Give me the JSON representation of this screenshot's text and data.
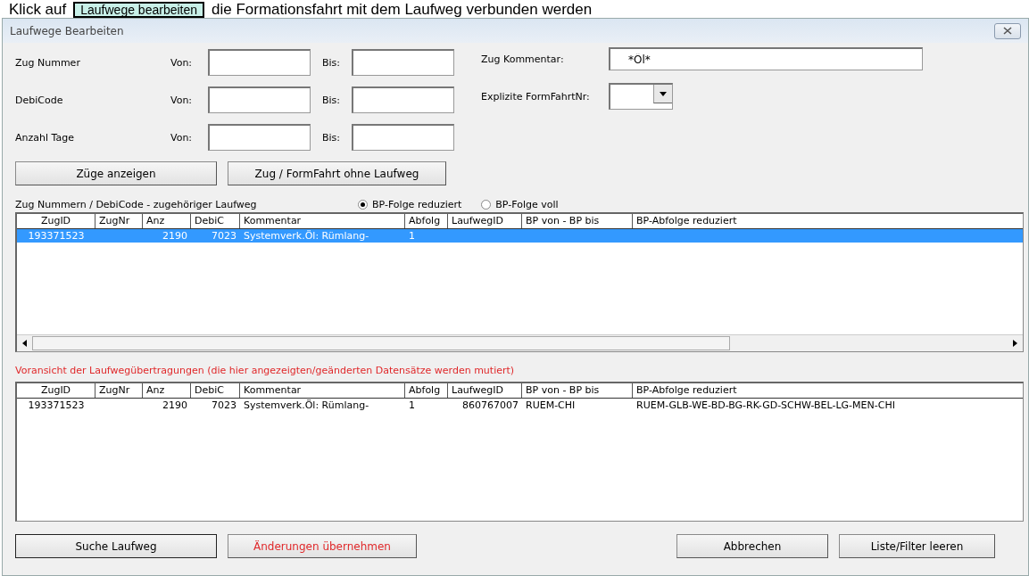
{
  "caption": {
    "before": "Klick auf",
    "button": "Laufwege bearbeiten",
    "after": "die Formationsfahrt mit dem Laufweg verbunden werden"
  },
  "window": {
    "title": "Laufwege Bearbeiten"
  },
  "filters": [
    {
      "label": "Zug Nummer",
      "from_label": "Von:",
      "to_label": "Bis:"
    },
    {
      "label": "DebiCode",
      "from_label": "Von:",
      "to_label": "Bis:"
    },
    {
      "label": "Anzahl Tage",
      "from_label": "Von:",
      "to_label": "Bis:"
    }
  ],
  "comment": {
    "label": "Zug Kommentar:",
    "value": "*Öl*"
  },
  "formfahrt": {
    "label": "Explizite FormFahrtNr:"
  },
  "action_buttons": [
    "Züge anzeigen",
    "Zug / FormFahrt ohne Laufweg"
  ],
  "list_label": "Zug Nummern / DebiCode - zugehöriger Laufweg",
  "radios": [
    {
      "label": "BP-Folge reduziert",
      "selected": true
    },
    {
      "label": "BP-Folge voll",
      "selected": false
    }
  ],
  "table": {
    "columns": [
      "ZugID",
      "ZugNr",
      "Anz",
      "DebiC",
      "Kommentar",
      "Abfolg",
      "LaufwegID",
      "BP von - BP bis",
      "BP-Abfolge reduziert"
    ],
    "rows": [
      {
        "selected": true,
        "cells": [
          "193371523",
          "",
          "2190",
          "7023",
          "Systemverk.Öl: Rümlang-",
          "1",
          "",
          "",
          ""
        ]
      }
    ]
  },
  "preview_label": "Voransicht der Laufwegübertragungen (die hier angezeigten/geänderten Datensätze werden mutiert)",
  "preview_table": {
    "columns": [
      "ZugID",
      "ZugNr",
      "Anz",
      "DebiC",
      "Kommentar",
      "Abfolg",
      "LaufwegID",
      "BP von - BP bis",
      "BP-Abfolge reduziert"
    ],
    "rows": [
      {
        "selected": false,
        "cells": [
          "193371523",
          "",
          "2190",
          "7023",
          "Systemverk.Öl: Rümlang-",
          "1",
          "860767007",
          "RUEM-CHI",
          "RUEM-GLB-WE-BD-BG-RK-GD-SCHW-BEL-LG-MEN-CHI"
        ]
      }
    ]
  },
  "bottom_buttons": [
    {
      "label": "Suche Laufweg",
      "kind": "default"
    },
    {
      "label": "Änderungen übernehmen",
      "kind": "warning"
    },
    {
      "label": "Abbrechen",
      "kind": "normal"
    },
    {
      "label": "Liste/Filter leeren",
      "kind": "normal"
    }
  ]
}
